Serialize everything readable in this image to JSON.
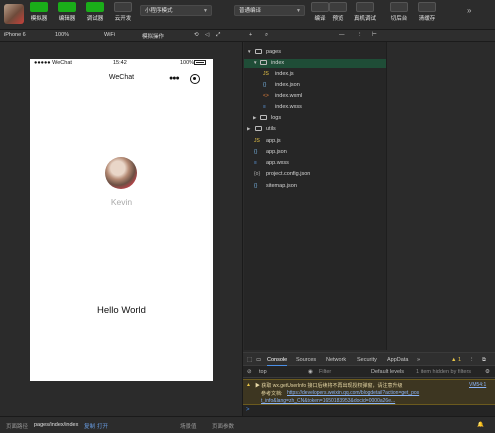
{
  "toolbar": {
    "buttons": [
      {
        "label": "模拟器",
        "active": true
      },
      {
        "label": "编辑器",
        "active": true
      },
      {
        "label": "调试器",
        "active": true
      },
      {
        "label": "云开发",
        "active": false
      }
    ],
    "mode_select": "小程序模式",
    "compile_select": "普通编译",
    "actions": [
      "编译",
      "预览",
      "真机调试",
      "切后台",
      "清缓存"
    ],
    "expand": "»"
  },
  "subbar": {
    "device": "iPhone 6",
    "zoom": "100%",
    "network": "WiFi",
    "operation": "模拟操作"
  },
  "phone": {
    "signal": "●●●●● WeChat",
    "time": "15:42",
    "battery": "100%",
    "nav_title": "WeChat",
    "nickname": "Kevin",
    "motto": "Hello World"
  },
  "file_tree": [
    {
      "name": "pages",
      "type": "folder",
      "open": true,
      "depth": 0
    },
    {
      "name": "index",
      "type": "folder",
      "open": true,
      "depth": 1,
      "selected": true
    },
    {
      "name": "index.js",
      "type": "js",
      "depth": 2
    },
    {
      "name": "index.json",
      "type": "json",
      "depth": 2
    },
    {
      "name": "index.wxml",
      "type": "wxml",
      "depth": 2
    },
    {
      "name": "index.wxss",
      "type": "wxss",
      "depth": 2
    },
    {
      "name": "logs",
      "type": "folder",
      "open": false,
      "depth": 1
    },
    {
      "name": "utils",
      "type": "folder",
      "open": false,
      "depth": 0
    },
    {
      "name": "app.js",
      "type": "js",
      "depth": 0
    },
    {
      "name": "app.json",
      "type": "json",
      "depth": 0
    },
    {
      "name": "app.wxss",
      "type": "wxss",
      "depth": 0
    },
    {
      "name": "project.config.json",
      "type": "config",
      "depth": 0
    },
    {
      "name": "sitemap.json",
      "type": "json",
      "depth": 0
    }
  ],
  "devtools": {
    "tabs": [
      "Console",
      "Sources",
      "Network",
      "Security",
      "AppData"
    ],
    "more": "»",
    "warning_count": "1",
    "context": "top",
    "filter_placeholder": "Filter",
    "levels": "Default levels",
    "hidden_by_filters": "1 item hidden by filters",
    "warning_line1": "▶ 获取 wx.getUserInfo 接口后续将不再出现授权弹窗，请注意升级",
    "warning_source": "VM54:1",
    "warning_line2_prefix": "参考文档: ",
    "warning_link1": "https://developers.weixin.qq.com/blogdetail?action=get_pos",
    "warning_link2": "t_info&lang=zh_CN&token=1650183953&docid=0000a26e...",
    "prompt": ">"
  },
  "statusbar": {
    "path_label": "页面路径",
    "path_value": "pages/index/index",
    "copy": "复制",
    "open": "打开",
    "scene": "场景值",
    "params": "页面参数"
  },
  "colors": {
    "accent": "#1aad19",
    "selected_row": "#1f4d37",
    "link": "#8ab4f8",
    "warning_bg": "#3d3621"
  }
}
